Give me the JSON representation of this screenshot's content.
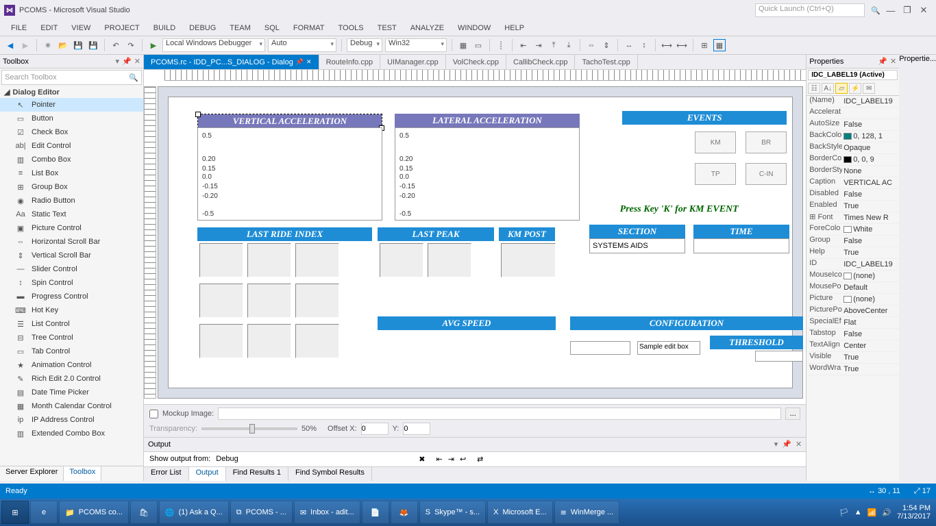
{
  "title": "PCOMS - Microsoft Visual Studio",
  "quicklaunch_placeholder": "Quick Launch (Ctrl+Q)",
  "menus": [
    "FILE",
    "EDIT",
    "VIEW",
    "PROJECT",
    "BUILD",
    "DEBUG",
    "TEAM",
    "SQL",
    "FORMAT",
    "TOOLS",
    "TEST",
    "ANALYZE",
    "WINDOW",
    "HELP"
  ],
  "toolbar": {
    "debugger": "Local Windows Debugger",
    "config1": "Auto",
    "config2": "Debug",
    "platform": "Win32"
  },
  "tabs": {
    "active": "PCOMS.rc - IDD_PC...S_DIALOG - Dialog",
    "others": [
      "RouteInfo.cpp",
      "UIManager.cpp",
      "VolCheck.cpp",
      "CallibCheck.cpp",
      "TachoTest.cpp"
    ]
  },
  "toolbox": {
    "header": "Toolbox",
    "search_placeholder": "Search Toolbox",
    "group": "Dialog Editor",
    "items": [
      {
        "icon": "↖",
        "label": "Pointer"
      },
      {
        "icon": "▭",
        "label": "Button"
      },
      {
        "icon": "☑",
        "label": "Check Box"
      },
      {
        "icon": "ab|",
        "label": "Edit Control"
      },
      {
        "icon": "▥",
        "label": "Combo Box"
      },
      {
        "icon": "≡",
        "label": "List Box"
      },
      {
        "icon": "⊞",
        "label": "Group Box"
      },
      {
        "icon": "◉",
        "label": "Radio Button"
      },
      {
        "icon": "Aa",
        "label": "Static Text"
      },
      {
        "icon": "▣",
        "label": "Picture Control"
      },
      {
        "icon": "⇔",
        "label": "Horizontal Scroll Bar"
      },
      {
        "icon": "⇕",
        "label": "Vertical Scroll Bar"
      },
      {
        "icon": "—",
        "label": "Slider Control"
      },
      {
        "icon": "↕",
        "label": "Spin Control"
      },
      {
        "icon": "▬",
        "label": "Progress Control"
      },
      {
        "icon": "⌨",
        "label": "Hot Key"
      },
      {
        "icon": "☰",
        "label": "List Control"
      },
      {
        "icon": "⊟",
        "label": "Tree Control"
      },
      {
        "icon": "▭",
        "label": "Tab Control"
      },
      {
        "icon": "★",
        "label": "Animation Control"
      },
      {
        "icon": "✎",
        "label": "Rich Edit 2.0 Control"
      },
      {
        "icon": "▤",
        "label": "Date Time Picker"
      },
      {
        "icon": "▦",
        "label": "Month Calendar Control"
      },
      {
        "icon": "ip",
        "label": "IP Address Control"
      },
      {
        "icon": "▥",
        "label": "Extended Combo Box"
      }
    ],
    "bottom_tabs": [
      "Server Explorer",
      "Toolbox"
    ]
  },
  "dialog": {
    "vert_title": "VERTICAL ACCELERATION",
    "lat_title": "LATERAL ACCELERATION",
    "axis_values": [
      "0.5",
      "0.20",
      "0.15",
      "0.0",
      "-0.15",
      "-0.20",
      "-0.5"
    ],
    "events_title": "EVENTS",
    "event_btns": [
      "KM",
      "BR",
      "TP",
      "C-IN"
    ],
    "km_msg": "Press Key 'K' for KM EVENT",
    "last_ride": "LAST RIDE INDEX",
    "last_peak": "LAST PEAK",
    "km_post": "KM POST",
    "section": "SECTION",
    "section_val": "SYSTEMS AIDS",
    "time": "TIME",
    "avg_speed": "AVG SPEED",
    "configuration": "CONFIGURATION",
    "threshold": "THRESHOLD",
    "sample_edit": "Sample edit box"
  },
  "design_ctrl": {
    "mockup_label": "Mockup Image:",
    "transparency_label": "Transparency:",
    "transparency_val": "50%",
    "offsetx_label": "Offset X:",
    "offsetx_val": "0",
    "offsety_label": "Y:",
    "offsety_val": "0"
  },
  "output": {
    "title": "Output",
    "show_label": "Show output from:",
    "show_val": "Debug",
    "tabs": [
      "Error List",
      "Output",
      "Find Results 1",
      "Find Symbol Results"
    ]
  },
  "properties": {
    "float_label": "Propertie...",
    "title": "Properties",
    "obj": "IDC_LABEL19 (Active)",
    "rows": [
      {
        "k": "(Name)",
        "v": "IDC_LABEL19"
      },
      {
        "k": "Accelerat",
        "v": ""
      },
      {
        "k": "AutoSize",
        "v": "False"
      },
      {
        "k": "BackColo",
        "v": "0, 128, 1",
        "swatch": "#008080"
      },
      {
        "k": "BackStyle",
        "v": "Opaque"
      },
      {
        "k": "BorderCo",
        "v": "0, 0, 9",
        "swatch": "#000009"
      },
      {
        "k": "BorderSty",
        "v": "None"
      },
      {
        "k": "Caption",
        "v": "VERTICAL AC"
      },
      {
        "k": "Disabled",
        "v": "False"
      },
      {
        "k": "Enabled",
        "v": "True"
      },
      {
        "k": "Font",
        "v": "Times New R",
        "expand": true
      },
      {
        "k": "ForeColo",
        "v": "White",
        "swatch": "#ffffff"
      },
      {
        "k": "Group",
        "v": "False"
      },
      {
        "k": "Help",
        "v": "True"
      },
      {
        "k": "ID",
        "v": "IDC_LABEL19"
      },
      {
        "k": "MouseIco",
        "v": "(none)",
        "swatch": "#ffffff"
      },
      {
        "k": "MousePo",
        "v": "Default"
      },
      {
        "k": "Picture",
        "v": "(none)",
        "swatch": "#ffffff"
      },
      {
        "k": "PicturePo",
        "v": "AboveCenter"
      },
      {
        "k": "SpecialEf",
        "v": "Flat"
      },
      {
        "k": "Tabstop",
        "v": "False"
      },
      {
        "k": "TextAlign",
        "v": "Center"
      },
      {
        "k": "Visible",
        "v": "True"
      },
      {
        "k": "WordWra",
        "v": "True"
      }
    ]
  },
  "status": {
    "ready": "Ready",
    "pos": "30 , 11",
    "size": "17"
  },
  "taskbar": {
    "items": [
      {
        "icon": "⊞",
        "label": "",
        "iconOnly": true,
        "cls": "start"
      },
      {
        "icon": "e",
        "label": "",
        "iconOnly": true
      },
      {
        "icon": "📁",
        "label": "PCOMS co..."
      },
      {
        "icon": "🛍",
        "label": "",
        "iconOnly": true
      },
      {
        "icon": "🌐",
        "label": "(1) Ask a Q..."
      },
      {
        "icon": "⧉",
        "label": "PCOMS - ..."
      },
      {
        "icon": "✉",
        "label": "Inbox - adit..."
      },
      {
        "icon": "📄",
        "label": "",
        "iconOnly": true
      },
      {
        "icon": "🦊",
        "label": "",
        "iconOnly": true
      },
      {
        "icon": "S",
        "label": "Skype™ - s..."
      },
      {
        "icon": "X",
        "label": "Microsoft E..."
      },
      {
        "icon": "≋",
        "label": "WinMerge ..."
      }
    ],
    "time": "1:54 PM",
    "date": "7/13/2017"
  }
}
